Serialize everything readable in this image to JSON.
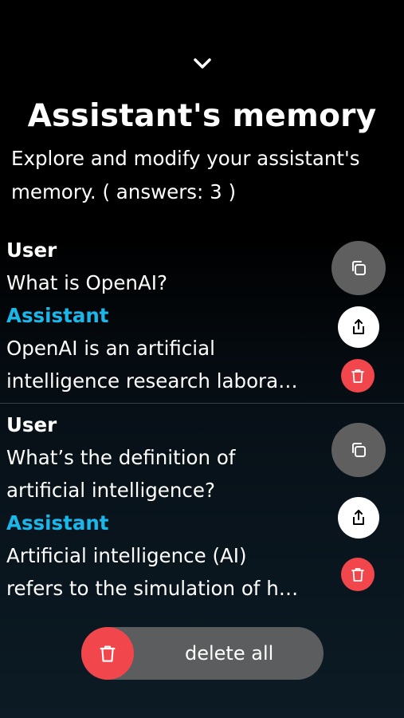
{
  "header": {
    "collapse_icon": "chevron-down-icon",
    "title": "Assistant's memory",
    "subtitle_line1": "Explore and modify your assistant's",
    "subtitle_line2": "memory. ( answers: 3 )"
  },
  "entries": [
    {
      "user_label": "User",
      "question_lines": [
        "What is OpenAI?"
      ],
      "assistant_label": "Assistant",
      "answer_lines": [
        "OpenAI is an artificial",
        "intelligence research labora…"
      ]
    },
    {
      "user_label": "User",
      "question_lines": [
        "What’s the definition of",
        "artificial intelligence?"
      ],
      "assistant_label": "Assistant",
      "answer_lines": [
        "Artificial intelligence (AI)",
        "refers to the simulation of h…"
      ]
    }
  ],
  "actions": {
    "copy_icon": "copy-icon",
    "share_icon": "share-icon",
    "delete_icon": "trash-icon"
  },
  "footer": {
    "delete_all_label": "delete all",
    "delete_all_icon": "trash-icon"
  },
  "colors": {
    "assistant_accent": "#1ab7ea",
    "danger": "#f1464b",
    "button_gray": "#5f5f5f"
  }
}
